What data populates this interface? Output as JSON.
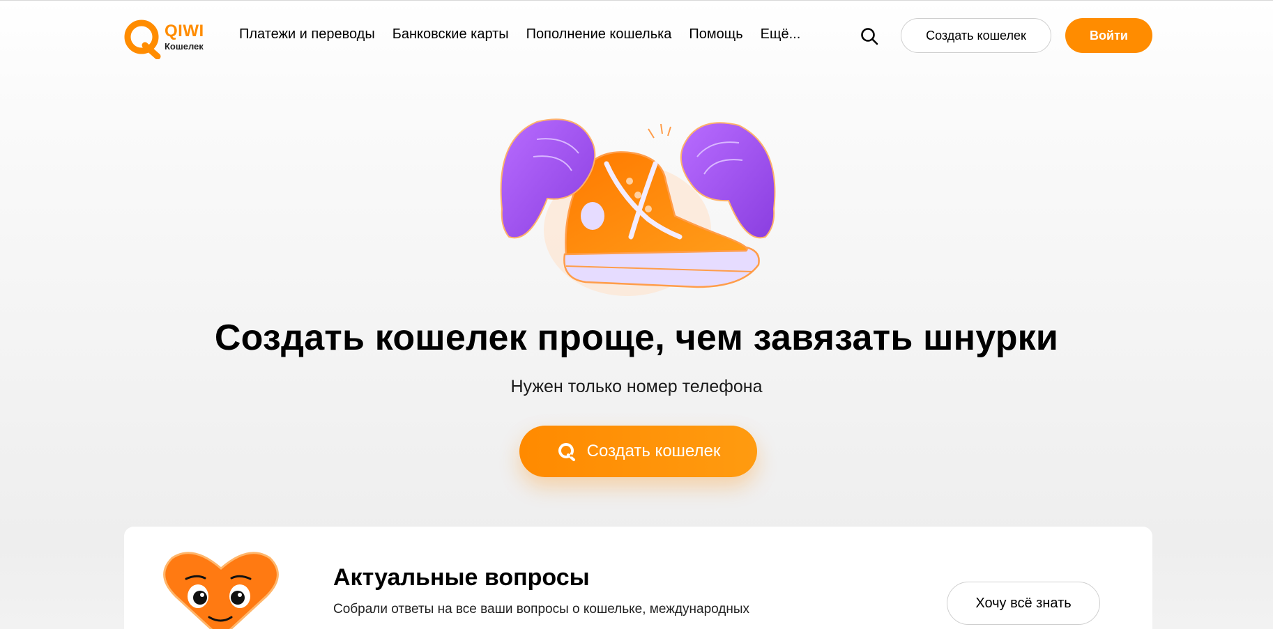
{
  "header": {
    "logo_brand": "QIWI",
    "logo_sub": "Кошелек",
    "nav": [
      {
        "label": "Платежи и переводы"
      },
      {
        "label": "Банковские карты"
      },
      {
        "label": "Пополнение кошелька"
      },
      {
        "label": "Помощь"
      },
      {
        "label": "Ещё..."
      }
    ],
    "search_icon": "search-icon",
    "create_wallet_label": "Создать кошелек",
    "login_label": "Войти"
  },
  "hero": {
    "title": "Создать кошелек проще, чем завязать шнурки",
    "subtitle": "Нужен только номер телефона",
    "cta_label": "Создать кошелек",
    "cta_icon": "qiwi-logo-icon"
  },
  "faq_card": {
    "title": "Актуальные вопросы",
    "text": "Собрали ответы на все ваши вопросы о кошельке, международных",
    "button_label": "Хочу всё знать"
  },
  "colors": {
    "accent": "#ff8c00",
    "purple": "#9b59f0",
    "text": "#000000"
  }
}
